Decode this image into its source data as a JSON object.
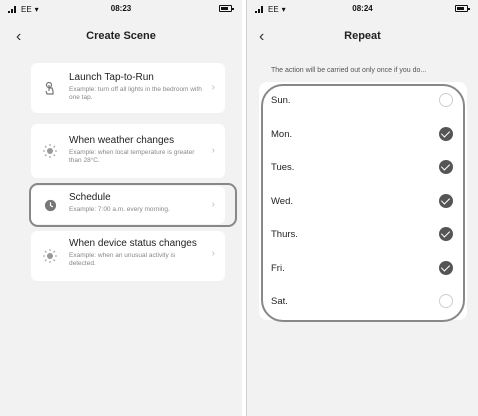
{
  "left": {
    "status": {
      "carrier": "EE",
      "time": "08:23"
    },
    "title": "Create Scene",
    "cards": [
      {
        "title": "Launch Tap-to-Run",
        "desc": "Example: turn off all lights in the bedroom with one tap.",
        "icon": "hand-tap-icon"
      },
      {
        "title": "When weather changes",
        "desc": "Example: when local temperature is greater than 28°C.",
        "icon": "sun-icon"
      },
      {
        "title": "Schedule",
        "desc": "Example: 7:00 a.m. every morning.",
        "icon": "clock-icon"
      },
      {
        "title": "When device status changes",
        "desc": "Example: when an unusual activity is detected.",
        "icon": "device-sun-icon"
      }
    ]
  },
  "right": {
    "status": {
      "carrier": "EE",
      "time": "08:24"
    },
    "title": "Repeat",
    "note": "The action will be carried out only once if you do...",
    "days": [
      {
        "label": "Sun.",
        "checked": false
      },
      {
        "label": "Mon.",
        "checked": true
      },
      {
        "label": "Tues.",
        "checked": true
      },
      {
        "label": "Wed.",
        "checked": true
      },
      {
        "label": "Thurs.",
        "checked": true
      },
      {
        "label": "Fri.",
        "checked": true
      },
      {
        "label": "Sat.",
        "checked": false
      }
    ]
  },
  "colors": {
    "background": "#f2f2f2",
    "card": "#ffffff",
    "check": "#555555",
    "outline": "#888888"
  }
}
